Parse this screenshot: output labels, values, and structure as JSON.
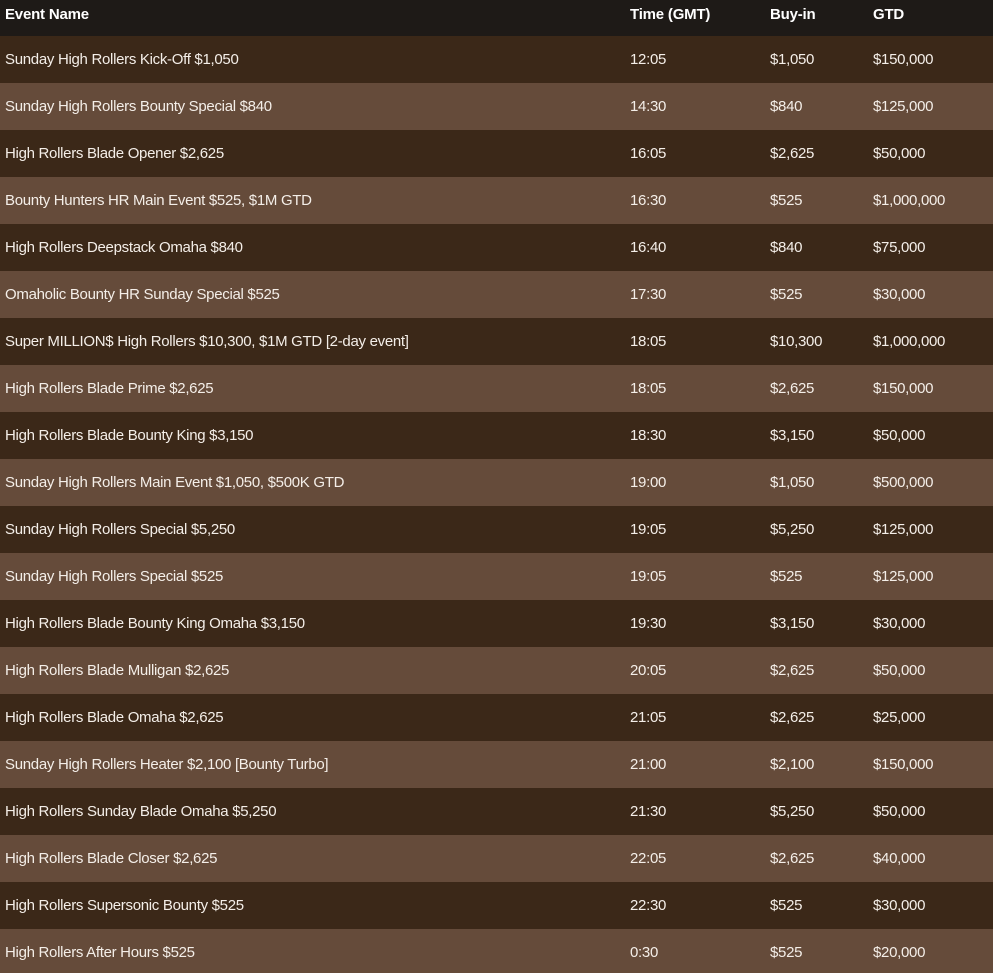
{
  "headers": {
    "event_name": "Event Name",
    "time": "Time (GMT)",
    "buy_in": "Buy-in",
    "gtd": "GTD"
  },
  "rows": [
    {
      "name": "Sunday High Rollers Kick-Off $1,050",
      "time": "12:05",
      "buy_in": "$1,050",
      "gtd": "$150,000"
    },
    {
      "name": "Sunday High Rollers Bounty Special $840",
      "time": "14:30",
      "buy_in": "$840",
      "gtd": "$125,000"
    },
    {
      "name": "High Rollers Blade Opener $2,625",
      "time": "16:05",
      "buy_in": "$2,625",
      "gtd": "$50,000"
    },
    {
      "name": "Bounty Hunters HR Main Event $525, $1M GTD",
      "time": "16:30",
      "buy_in": "$525",
      "gtd": "$1,000,000"
    },
    {
      "name": "High Rollers Deepstack Omaha $840",
      "time": "16:40",
      "buy_in": "$840",
      "gtd": "$75,000"
    },
    {
      "name": "Omaholic Bounty HR Sunday Special $525",
      "time": "17:30",
      "buy_in": "$525",
      "gtd": "$30,000"
    },
    {
      "name": "Super MILLION$ High Rollers $10,300, $1M GTD [2-day event]",
      "time": "18:05",
      "buy_in": "$10,300",
      "gtd": "$1,000,000"
    },
    {
      "name": "High Rollers Blade Prime $2,625",
      "time": "18:05",
      "buy_in": "$2,625",
      "gtd": "$150,000"
    },
    {
      "name": "High Rollers Blade Bounty King $3,150",
      "time": "18:30",
      "buy_in": "$3,150",
      "gtd": "$50,000"
    },
    {
      "name": "Sunday High Rollers Main Event $1,050, $500K GTD",
      "time": "19:00",
      "buy_in": "$1,050",
      "gtd": "$500,000"
    },
    {
      "name": "Sunday High Rollers Special $5,250",
      "time": "19:05",
      "buy_in": "$5,250",
      "gtd": "$125,000"
    },
    {
      "name": "Sunday High Rollers Special $525",
      "time": "19:05",
      "buy_in": "$525",
      "gtd": "$125,000"
    },
    {
      "name": "High Rollers Blade Bounty King Omaha $3,150",
      "time": "19:30",
      "buy_in": "$3,150",
      "gtd": "$30,000"
    },
    {
      "name": "High Rollers Blade Mulligan $2,625",
      "time": "20:05",
      "buy_in": "$2,625",
      "gtd": "$50,000"
    },
    {
      "name": "High Rollers Blade Omaha $2,625",
      "time": "21:05",
      "buy_in": "$2,625",
      "gtd": "$25,000"
    },
    {
      "name": "Sunday High Rollers Heater $2,100 [Bounty Turbo]",
      "time": "21:00",
      "buy_in": "$2,100",
      "gtd": "$150,000"
    },
    {
      "name": "High Rollers Sunday Blade Omaha $5,250",
      "time": "21:30",
      "buy_in": "$5,250",
      "gtd": "$50,000"
    },
    {
      "name": "High Rollers Blade Closer $2,625",
      "time": "22:05",
      "buy_in": "$2,625",
      "gtd": "$40,000"
    },
    {
      "name": "High Rollers Supersonic Bounty $525",
      "time": "22:30",
      "buy_in": "$525",
      "gtd": "$30,000"
    },
    {
      "name": "High Rollers After Hours $525",
      "time": "0:30",
      "buy_in": "$525",
      "gtd": "$20,000"
    }
  ],
  "colors": {
    "header_bg": "#1e1a17",
    "row_dark": "#3b2818",
    "row_light": "#654b3a",
    "text": "#f4eee8"
  }
}
